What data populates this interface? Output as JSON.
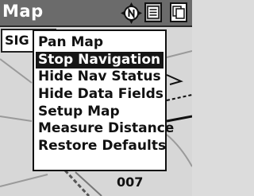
{
  "app": {
    "title": "Map"
  },
  "toolbar": {
    "compass_icon": "north-up-icon",
    "menu_icon": "menu-list-icon",
    "pages_icon": "pages-icon"
  },
  "map": {
    "data_field_label": "SIG",
    "route_label": "007"
  },
  "menu": {
    "items": [
      {
        "label": "Pan Map",
        "selected": false
      },
      {
        "label": "Stop Navigation",
        "selected": true
      },
      {
        "label": "Hide Nav Status",
        "selected": false
      },
      {
        "label": "Hide Data Fields",
        "selected": false
      },
      {
        "label": "Setup Map",
        "selected": false
      },
      {
        "label": "Measure Distance",
        "selected": false
      },
      {
        "label": "Restore Defaults",
        "selected": false
      }
    ]
  },
  "colors": {
    "titlebar": "#6b6b6b",
    "selection": "#161616",
    "map_background": "#d7d7d7"
  }
}
